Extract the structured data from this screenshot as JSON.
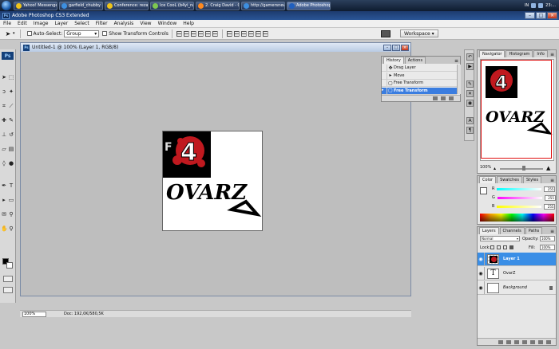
{
  "taskbar": {
    "items": [
      {
        "label": "Yahoo! Messenger",
        "color": "#f0c419"
      },
      {
        "label": "garfield_chubby",
        "color": "#3d8fe0"
      },
      {
        "label": "Conference: rezapr...",
        "color": "#f0c419"
      },
      {
        "label": "Ice CooL (b4yi_ngu...",
        "color": "#7ec850"
      },
      {
        "label": "2. Craig David - Cra...",
        "color": "#ff8a1f"
      },
      {
        "label": "http://gamersnews.i...",
        "color": "#3d8fe0"
      },
      {
        "label": "Adobe Photoshop C...",
        "color": "#1f5fbf"
      }
    ],
    "tray_lang": "IN",
    "clock": "23:..."
  },
  "window": {
    "title": "Adobe Photoshop CS3 Extended",
    "app_badge": "Ps"
  },
  "menu": [
    "File",
    "Edit",
    "Image",
    "Layer",
    "Select",
    "Filter",
    "Analysis",
    "View",
    "Window",
    "Help"
  ],
  "options": {
    "auto_select_label": "Auto-Select:",
    "auto_select_value": "Group",
    "transform_label": "Show Transform Controls",
    "workspace_label": "Workspace"
  },
  "document": {
    "title": "Untitled-1 @ 100% (Layer 1, RGB/8)",
    "zoom": "100%",
    "doc_size": "Doc: 192,0K/580,5K"
  },
  "history": {
    "tabs": [
      "History",
      "Actions"
    ],
    "items": [
      {
        "label": "Drag Layer",
        "icon": "move-icon",
        "glyph": "✥"
      },
      {
        "label": "Move",
        "icon": "move-icon",
        "glyph": "▸"
      },
      {
        "label": "Free Transform",
        "icon": "transform-icon",
        "glyph": "▢"
      },
      {
        "label": "Free Transform",
        "icon": "transform-icon",
        "glyph": "▢"
      }
    ],
    "selected_index": 3
  },
  "navigator": {
    "tabs": [
      "Navigator",
      "Histogram",
      "Info"
    ],
    "zoom": "100%"
  },
  "color": {
    "tabs": [
      "Color",
      "Swatches",
      "Styles"
    ],
    "channels": [
      {
        "name": "R",
        "value": "255",
        "gradient": "linear-gradient(to right,#00ffff,#ffffff)"
      },
      {
        "name": "G",
        "value": "255",
        "gradient": "linear-gradient(to right,#ff00ff,#ffffff)"
      },
      {
        "name": "B",
        "value": "255",
        "gradient": "linear-gradient(to right,#ffff00,#ffffff)"
      }
    ]
  },
  "layers": {
    "tabs": [
      "Layers",
      "Channels",
      "Paths"
    ],
    "blend_mode": "Normal",
    "opacity_label": "Opacity:",
    "opacity_value": "100%",
    "lock_label": "Lock:",
    "fill_label": "Fill:",
    "fill_value": "100%",
    "items": [
      {
        "name": "Layer 1",
        "type": "image",
        "selected": true
      },
      {
        "name": "OvarZ",
        "type": "text",
        "selected": false
      },
      {
        "name": "Background",
        "type": "background",
        "selected": false
      }
    ]
  },
  "artwork": {
    "text": "OVARZ",
    "big_digit": "4",
    "letters_left": "F",
    "accent": "#c0191f"
  }
}
